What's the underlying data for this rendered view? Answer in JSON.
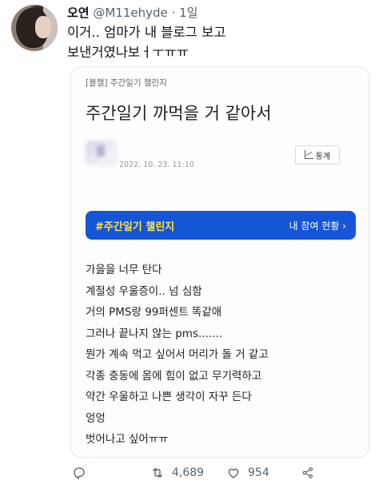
{
  "tweet": {
    "author_name": "오연",
    "handle": "@M11ehyde",
    "separator": "·",
    "time": "1일",
    "text_lines": [
      "이거.. 엄마가 내 블로그 보고",
      "보낸거였나보ㅓㅜㅠㅠ"
    ]
  },
  "card": {
    "category_tag": "[블챌] 주간일기 챌린지",
    "title": "주간일기 까먹을 거 같아서",
    "date": "2022. 10. 23. 11:10",
    "stats_label": "통계",
    "challenge_label": "#주간일기 챌린지",
    "challenge_action": "내 참여 현황 ›",
    "body_lines": [
      "가을을 너무 탄다",
      "계절성 우울증이.. 넘 심함",
      "거의 PMS랑 99퍼센트 똑같애",
      "그러나 끝나지 않는 pms.......",
      "뭔가 계속 먹고 싶어서 머리가 돌 거 같고",
      "각종 충동에 몸에 힘이 없고 무기력하고",
      "약간 우울하고 나쁜 생각이 자꾸 든다",
      "엉엉",
      "벗어나고 싶어ㅠㅠ"
    ]
  },
  "actions": {
    "retweets": "4,689",
    "likes": "954"
  },
  "colors": {
    "challenge_bar": "#1556d6",
    "challenge_text": "#ffe14a",
    "muted": "#536471"
  }
}
